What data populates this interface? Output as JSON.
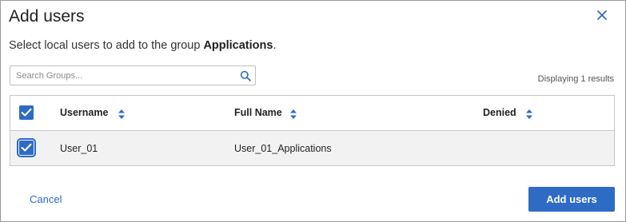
{
  "dialog": {
    "title": "Add users",
    "subtitle_prefix": "Select local users to add to the group ",
    "group_name": "Applications",
    "subtitle_suffix": ".",
    "close_icon": "close-icon"
  },
  "search": {
    "placeholder": "Search Groups...",
    "value": "",
    "icon": "search-icon"
  },
  "results_text": "Displaying 1 results",
  "table": {
    "header_checked": true,
    "columns": [
      "Username",
      "Full Name",
      "Denied"
    ],
    "sort_icon": "sort-icon",
    "rows": [
      {
        "checked": true,
        "username": "User_01",
        "full_name": "User_01_Applications",
        "denied": ""
      }
    ]
  },
  "footer": {
    "cancel_label": "Cancel",
    "submit_label": "Add users"
  },
  "colors": {
    "accent": "#2e6bc5",
    "row_bg": "#f2f2f2",
    "border": "#c8c8c8"
  }
}
